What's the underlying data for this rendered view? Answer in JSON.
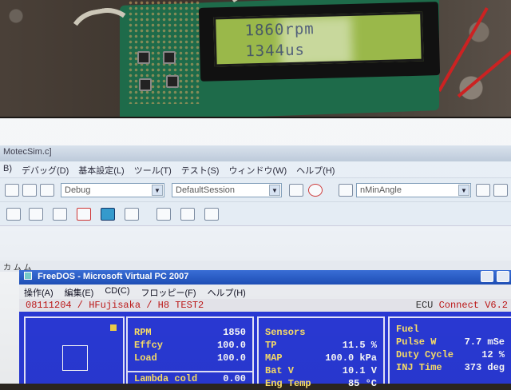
{
  "lcd": {
    "line1": "1860rpm",
    "line2": "1344us"
  },
  "ide": {
    "window_title": "MotecSim.c]",
    "menu": [
      "B)",
      "デバッグ(D)",
      "基本設定(L)",
      "ツール(T)",
      "テスト(S)",
      "ウィンドウ(W)",
      "ヘルプ(H)"
    ],
    "combo_config": "Debug",
    "combo_session": "DefaultSession",
    "combo_symbol": "nMinAngle",
    "tab_label": "カ ム ム"
  },
  "vpc": {
    "title": "FreeDOS - Microsoft Virtual PC 2007",
    "menu": [
      "操作(A)",
      "編集(E)",
      "CD(C)",
      "フロッピー(F)",
      "ヘルプ(H)"
    ]
  },
  "dos": {
    "header_left": "08111204 / HFujisaka  / H8 TEST2",
    "header_right_a": "ECU",
    "header_right_b": "Connect V6.2",
    "engine": {
      "rpm_label": "RPM",
      "rpm_value": "1850",
      "effcy_label": "Effcy",
      "effcy_value": "100.0",
      "load_label": "Load",
      "load_value": "100.0",
      "lambda_label": "Lambda  cold",
      "lambda_value": "0.00"
    },
    "sensors": {
      "title": "Sensors",
      "tp_label": "TP",
      "tp_value": "11.5 %",
      "map_label": "MAP",
      "map_value": "100.0 kPa",
      "bat_label": "Bat V",
      "bat_value": "10.1 V",
      "eng_label": "Eng Temp",
      "eng_value": "85 °C"
    },
    "fuel": {
      "title": "Fuel",
      "pulse_label": "Pulse W",
      "pulse_value": "7.7 mSe",
      "duty_label": "Duty Cycle",
      "duty_value": "12 %",
      "inj_label": "INJ Time",
      "inj_value": "373 deg"
    }
  }
}
